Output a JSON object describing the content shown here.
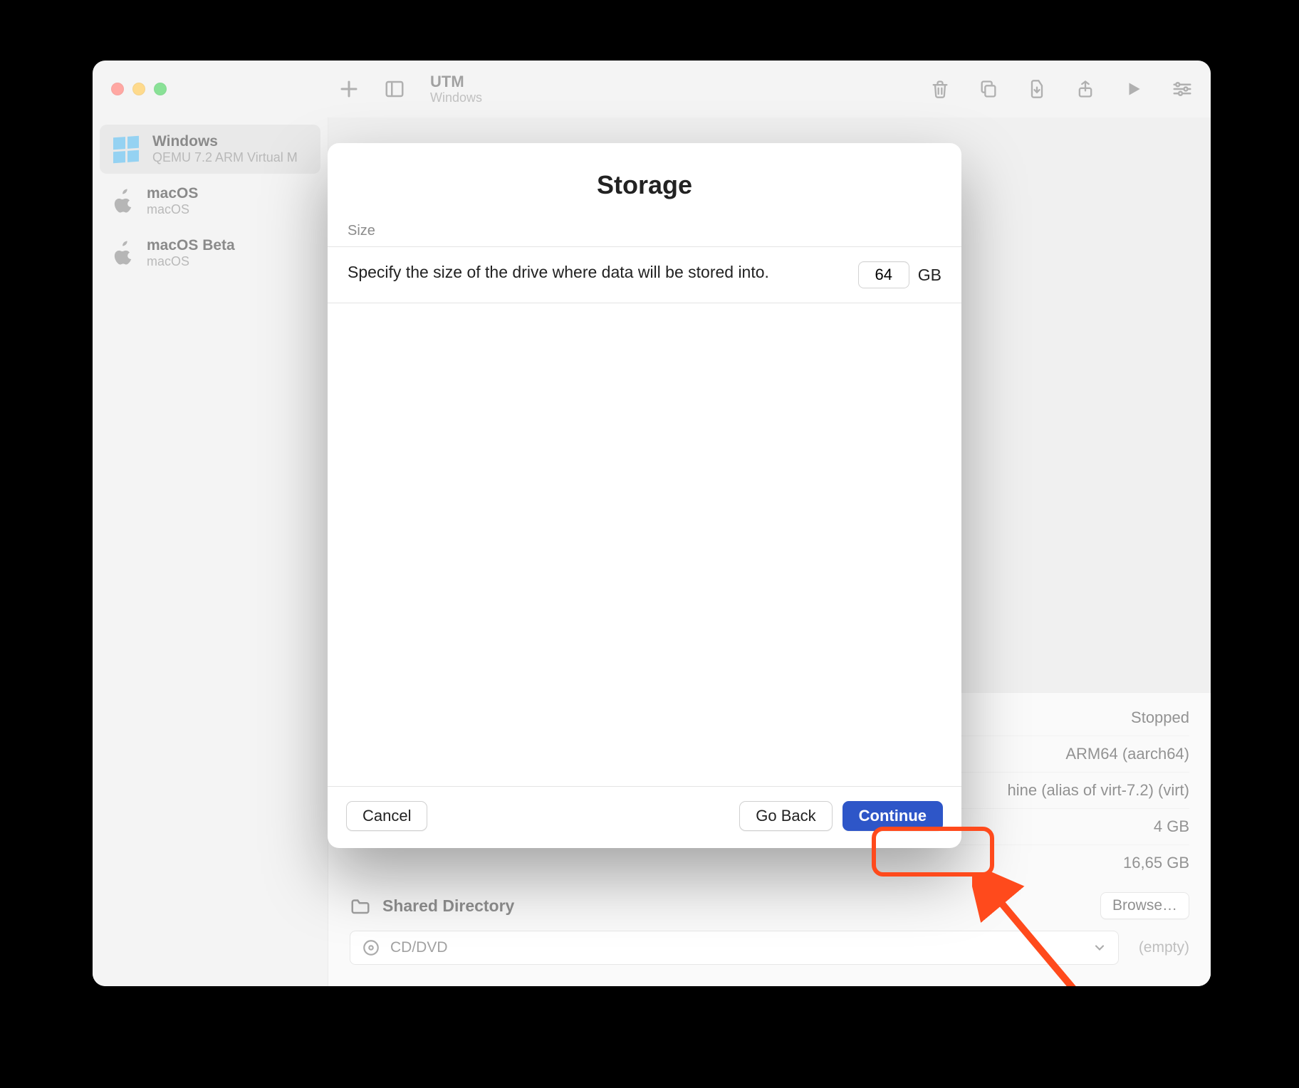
{
  "header": {
    "title": "UTM",
    "subtitle": "Windows"
  },
  "sidebar": {
    "items": [
      {
        "name": "Windows",
        "detail": "QEMU 7.2 ARM Virtual M"
      },
      {
        "name": "macOS",
        "detail": "macOS"
      },
      {
        "name": "macOS Beta",
        "detail": "macOS"
      }
    ]
  },
  "details": {
    "status": "Stopped",
    "arch": "ARM64 (aarch64)",
    "machine": "hine (alias of virt-7.2) (virt)",
    "ram": "4 GB",
    "disk": "16,65 GB",
    "shared_label": "Shared Directory",
    "browse": "Browse…",
    "cd_label": "CD/DVD",
    "cd_status": "(empty)"
  },
  "sheet": {
    "title": "Storage",
    "section_label": "Size",
    "description": "Specify the size of the drive where data will be stored into.",
    "size_value": "64",
    "size_unit": "GB",
    "cancel": "Cancel",
    "go_back": "Go Back",
    "continue": "Continue"
  },
  "icons": {
    "add": "add-icon",
    "sidebar_toggle": "sidebar-toggle-icon",
    "trash": "trash-icon",
    "copy": "copy-icon",
    "import": "import-icon",
    "share": "share-icon",
    "play": "play-icon",
    "settings": "settings-icon"
  }
}
